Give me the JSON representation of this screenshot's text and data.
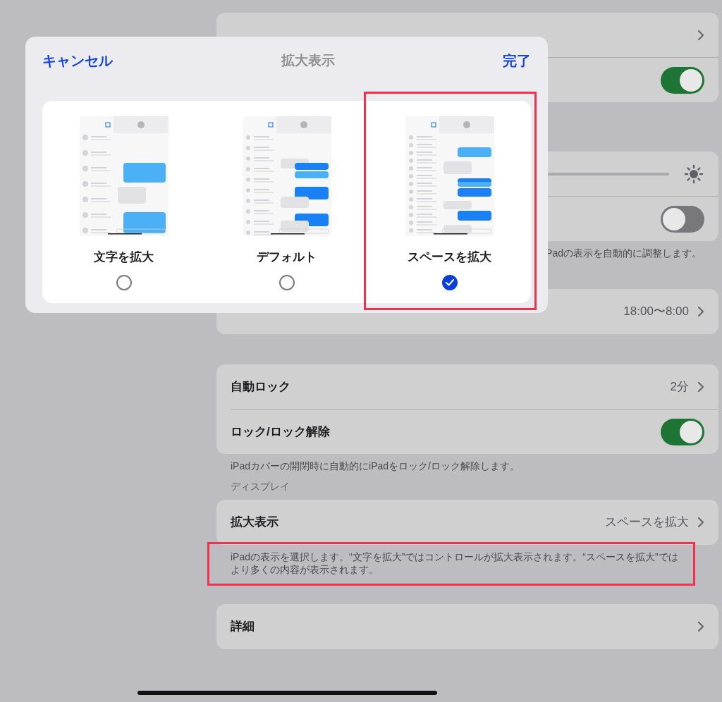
{
  "settings": {
    "groups": [
      {
        "rows": [
          {
            "kind": "link"
          },
          {
            "kind": "toggle",
            "on": true
          }
        ]
      },
      {
        "rows": [
          {
            "kind": "slider"
          },
          {
            "kind": "toggle",
            "on": false
          }
        ],
        "footer": "Padの表示を自動的に調整します。"
      },
      {
        "rows": [
          {
            "kind": "link",
            "value": "18:00〜8:00"
          }
        ]
      },
      {
        "rows": [
          {
            "kind": "link",
            "label": "自動ロック",
            "value": "2分"
          },
          {
            "kind": "toggle",
            "label": "ロック/ロック解除",
            "on": true
          }
        ],
        "footer": "iPadカバーの開閉時に自動的にiPadをロック/ロック解除します。"
      },
      {
        "header": "ディスプレイ",
        "rows": [
          {
            "kind": "link",
            "label": "拡大表示",
            "value": "スペースを拡大"
          }
        ],
        "footer": "iPadの表示を選択します。“文字を拡大”ではコントロールが拡大表示されます。“スペースを拡大”ではより多くの内容が表示されます。",
        "footer_highlighted": true
      },
      {
        "rows": [
          {
            "kind": "link",
            "label": "詳細"
          }
        ]
      }
    ]
  },
  "dialog": {
    "cancel": "キャンセル",
    "title": "拡大表示",
    "done": "完了",
    "options": [
      {
        "kind": "large_text",
        "label": "文字を拡大",
        "selected": false,
        "highlighted": false
      },
      {
        "kind": "default",
        "label": "デフォルト",
        "selected": false,
        "highlighted": false
      },
      {
        "kind": "more_space",
        "label": "スペースを拡大",
        "selected": true,
        "highlighted": true
      }
    ]
  }
}
